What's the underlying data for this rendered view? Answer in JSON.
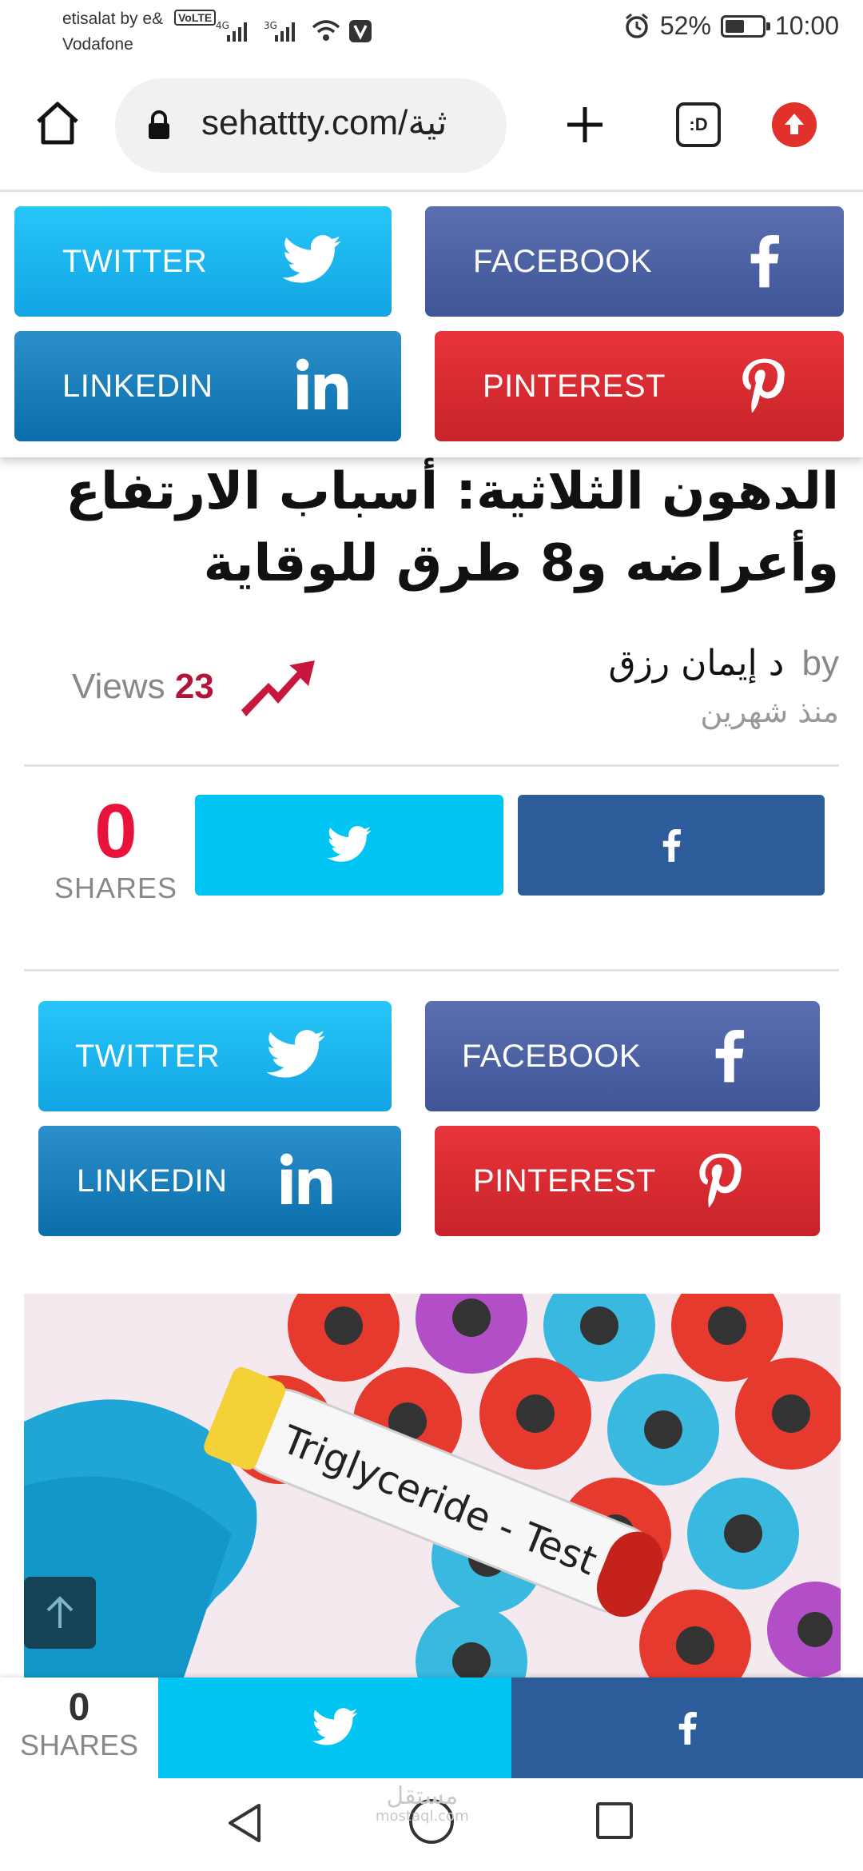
{
  "status_bar": {
    "carrier_line1": "etisalat by e&",
    "carrier_line2": "Vodafone",
    "volte": "VoLTE",
    "net1": "4G",
    "net2": "3G",
    "battery": "52%",
    "battery_level": 0.52,
    "time": "10:00"
  },
  "browser": {
    "url": "sehattty.com/ثية",
    "tabs_label": ":D"
  },
  "social_top": {
    "twitter": "TWITTER",
    "facebook": "FACEBOOK",
    "linkedin": "LINKEDIN",
    "pinterest": "PINTEREST"
  },
  "article": {
    "title": "الدهون الثلاثية: أسباب الارتفاع وأعراضه و8 طرق للوقاية",
    "by_label": "by",
    "author": "د إيمان رزق",
    "date": "منذ شهرين",
    "views_label": "Views",
    "views_count": "23"
  },
  "share_box": {
    "count": "0",
    "label": "SHARES"
  },
  "social_mid": {
    "twitter": "TWITTER",
    "facebook": "FACEBOOK",
    "linkedin": "LINKEDIN",
    "pinterest": "PINTEREST"
  },
  "image": {
    "tube_label": "Triglyceride - Test"
  },
  "bottom_bar": {
    "count": "0",
    "label": "SHARES"
  },
  "watermark": {
    "arabic": "مستقل",
    "latin": "mostaql.com"
  },
  "colors": {
    "twitter": "#1DA1F2",
    "facebook": "#3F5597",
    "linkedin": "#0B6EAC",
    "pinterest": "#C8232A",
    "shares_accent": "#E8133B"
  }
}
